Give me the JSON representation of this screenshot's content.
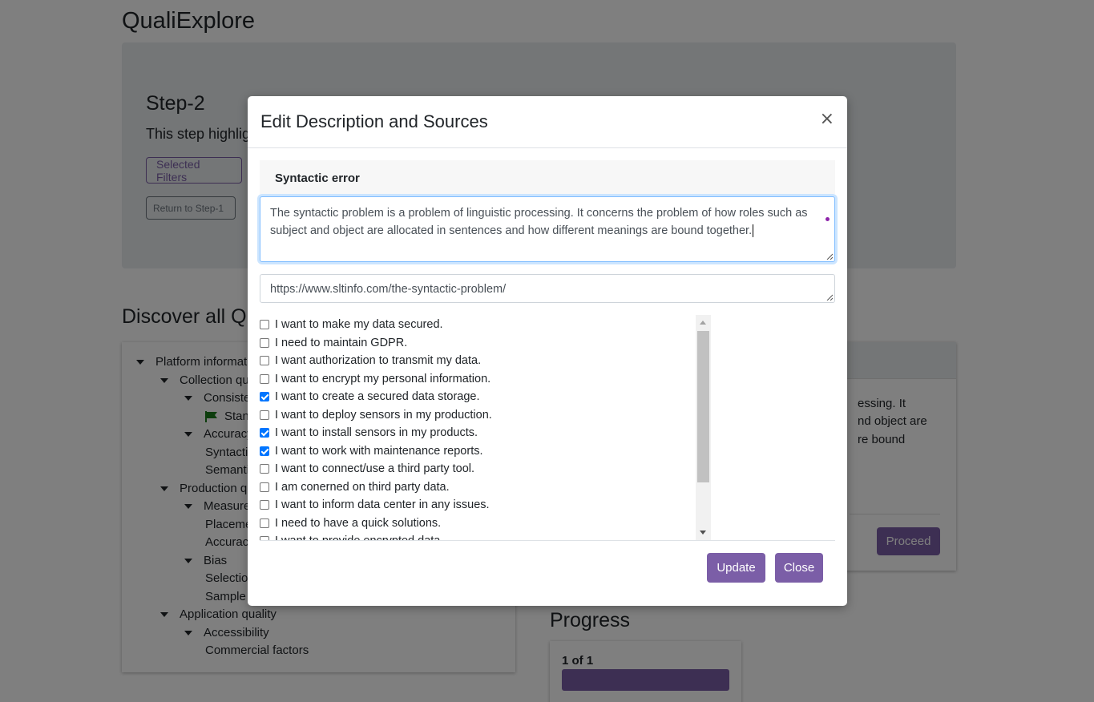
{
  "app": {
    "title": "QualiExplore"
  },
  "step": {
    "title": "Step-2",
    "description": "This step highlig",
    "selected_filters_label": "Selected Filters",
    "return_label": "Return to Step-1"
  },
  "discover": {
    "title": "Discover all Q"
  },
  "tree": [
    {
      "label": "Platform informat",
      "level": 0,
      "expanded": true
    },
    {
      "label": "Collection qu",
      "level": 1,
      "expanded": true
    },
    {
      "label": "Consiste",
      "level": 2,
      "expanded": true
    },
    {
      "label": "Stan",
      "level": 3,
      "flag": true
    },
    {
      "label": "Accuracy",
      "level": 2,
      "expanded": true
    },
    {
      "label": "Syntacti",
      "level": 3
    },
    {
      "label": "Semanti",
      "level": 3
    },
    {
      "label": "Production q",
      "level": 1,
      "expanded": true
    },
    {
      "label": "Measure",
      "level": 2,
      "expanded": true
    },
    {
      "label": "Placeme",
      "level": 3
    },
    {
      "label": "Accurac",
      "level": 3
    },
    {
      "label": "Bias",
      "level": 2,
      "expanded": true
    },
    {
      "label": "Selectio",
      "level": 3
    },
    {
      "label": "Sample",
      "level": 3
    },
    {
      "label": "Application quality",
      "level": 1,
      "expanded": true
    },
    {
      "label": "Accessibility",
      "level": 2,
      "expanded": true
    },
    {
      "label": "Commercial factors",
      "level": 3
    }
  ],
  "right_card": {
    "lines": [
      "essing. It",
      "nd object are",
      "re bound"
    ],
    "proceed_label": "Proceed"
  },
  "progress": {
    "title": "Progress",
    "count": "1 of 1",
    "fraction": 1.0
  },
  "modal": {
    "title": "Edit Description and Sources",
    "close_glyph": "×",
    "section_label": "Syntactic error",
    "description": "The syntactic problem is a problem of linguistic processing. It concerns the problem of how roles such as subject and object are allocated in sentences and how different meanings are bound together.",
    "source": "https://www.sltinfo.com/the-syntactic-problem/",
    "checklist": [
      {
        "label": "I want to make my data secured.",
        "checked": false
      },
      {
        "label": "I need to maintain GDPR.",
        "checked": false
      },
      {
        "label": "I want authorization to transmit my data.",
        "checked": false
      },
      {
        "label": "I want to encrypt my personal information.",
        "checked": false
      },
      {
        "label": "I want to create a secured data storage.",
        "checked": true
      },
      {
        "label": "I want to deploy sensors in my production.",
        "checked": false
      },
      {
        "label": "I want to install sensors in my products.",
        "checked": true
      },
      {
        "label": "I want to work with maintenance reports.",
        "checked": true
      },
      {
        "label": "I want to connect/use a third party tool.",
        "checked": false
      },
      {
        "label": "I am conerned on third party data.",
        "checked": false
      },
      {
        "label": "I want to inform data center in any issues.",
        "checked": false
      },
      {
        "label": "I need to have a quick solutions.",
        "checked": false
      },
      {
        "label": "I want to provide encrypted data.",
        "checked": false
      }
    ],
    "update_label": "Update",
    "close_label": "Close"
  }
}
